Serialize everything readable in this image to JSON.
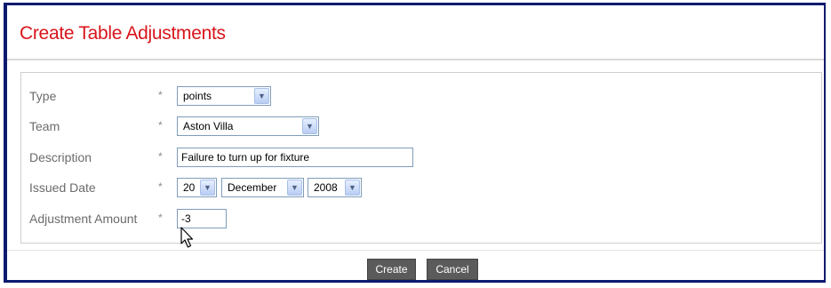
{
  "page": {
    "title": "Create Table Adjustments"
  },
  "form": {
    "required_marker": "*",
    "type": {
      "label": "Type",
      "value": "points"
    },
    "team": {
      "label": "Team",
      "value": "Aston Villa"
    },
    "description": {
      "label": "Description",
      "value": "Failure to turn up for fixture"
    },
    "issued_date": {
      "label": "Issued Date",
      "day": "20",
      "month": "December",
      "year": "2008"
    },
    "adjustment_amount": {
      "label": "Adjustment Amount",
      "value": "-3"
    }
  },
  "buttons": {
    "create": "Create",
    "cancel": "Cancel"
  },
  "colors": {
    "title": "#d9141b",
    "border": "#0a1a6e",
    "button_bg": "#5b5b5b"
  },
  "icons": {
    "dropdown": "chevron-down-icon",
    "cursor": "mouse-pointer-icon"
  }
}
